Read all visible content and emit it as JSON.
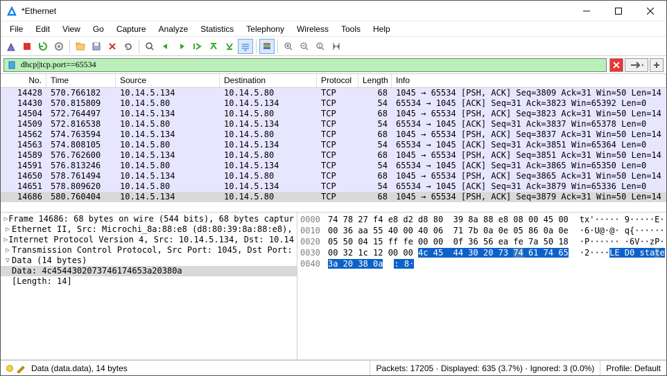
{
  "window": {
    "title": "*Ethernet"
  },
  "menu": [
    "File",
    "Edit",
    "View",
    "Go",
    "Capture",
    "Analyze",
    "Statistics",
    "Telephony",
    "Wireless",
    "Tools",
    "Help"
  ],
  "filter": {
    "text": "dhcp||tcp.port==65534"
  },
  "columns": {
    "no": "No.",
    "time": "Time",
    "source": "Source",
    "destination": "Destination",
    "protocol": "Protocol",
    "length": "Length",
    "info": "Info"
  },
  "packets": [
    {
      "no": "14428",
      "time": "570.766182",
      "src": "10.14.5.134",
      "dst": "10.14.5.80",
      "proto": "TCP",
      "len": "68",
      "info": "1045 → 65534 [PSH, ACK] Seq=3809 Ack=31 Win=50 Len=14"
    },
    {
      "no": "14430",
      "time": "570.815809",
      "src": "10.14.5.80",
      "dst": "10.14.5.134",
      "proto": "TCP",
      "len": "54",
      "info": "65534 → 1045 [ACK] Seq=31 Ack=3823 Win=65392 Len=0"
    },
    {
      "no": "14504",
      "time": "572.764497",
      "src": "10.14.5.134",
      "dst": "10.14.5.80",
      "proto": "TCP",
      "len": "68",
      "info": "1045 → 65534 [PSH, ACK] Seq=3823 Ack=31 Win=50 Len=14"
    },
    {
      "no": "14509",
      "time": "572.816538",
      "src": "10.14.5.80",
      "dst": "10.14.5.134",
      "proto": "TCP",
      "len": "54",
      "info": "65534 → 1045 [ACK] Seq=31 Ack=3837 Win=65378 Len=0"
    },
    {
      "no": "14562",
      "time": "574.763594",
      "src": "10.14.5.134",
      "dst": "10.14.5.80",
      "proto": "TCP",
      "len": "68",
      "info": "1045 → 65534 [PSH, ACK] Seq=3837 Ack=31 Win=50 Len=14"
    },
    {
      "no": "14563",
      "time": "574.808105",
      "src": "10.14.5.80",
      "dst": "10.14.5.134",
      "proto": "TCP",
      "len": "54",
      "info": "65534 → 1045 [ACK] Seq=31 Ack=3851 Win=65364 Len=0"
    },
    {
      "no": "14589",
      "time": "576.762600",
      "src": "10.14.5.134",
      "dst": "10.14.5.80",
      "proto": "TCP",
      "len": "68",
      "info": "1045 → 65534 [PSH, ACK] Seq=3851 Ack=31 Win=50 Len=14"
    },
    {
      "no": "14591",
      "time": "576.813246",
      "src": "10.14.5.80",
      "dst": "10.14.5.134",
      "proto": "TCP",
      "len": "54",
      "info": "65534 → 1045 [ACK] Seq=31 Ack=3865 Win=65350 Len=0"
    },
    {
      "no": "14650",
      "time": "578.761494",
      "src": "10.14.5.134",
      "dst": "10.14.5.80",
      "proto": "TCP",
      "len": "68",
      "info": "1045 → 65534 [PSH, ACK] Seq=3865 Ack=31 Win=50 Len=14"
    },
    {
      "no": "14651",
      "time": "578.809620",
      "src": "10.14.5.80",
      "dst": "10.14.5.134",
      "proto": "TCP",
      "len": "54",
      "info": "65534 → 1045 [ACK] Seq=31 Ack=3879 Win=65336 Len=0"
    },
    {
      "no": "14686",
      "time": "580.760404",
      "src": "10.14.5.134",
      "dst": "10.14.5.80",
      "proto": "TCP",
      "len": "68",
      "info": "1045 → 65534 [PSH, ACK] Seq=3879 Ack=31 Win=50 Len=14",
      "sel": true
    }
  ],
  "tree": [
    {
      "exp": ">",
      "text": "Frame 14686: 68 bytes on wire (544 bits), 68 bytes captur"
    },
    {
      "exp": ">",
      "text": "Ethernet II, Src: Microchi_8a:88:e8 (d8:80:39:8a:88:e8),"
    },
    {
      "exp": ">",
      "text": "Internet Protocol Version 4, Src: 10.14.5.134, Dst: 10.14"
    },
    {
      "exp": ">",
      "text": "Transmission Control Protocol, Src Port: 1045, Dst Port:"
    },
    {
      "exp": "v",
      "text": "Data (14 bytes)"
    },
    {
      "exp": "",
      "text": "    Data: 4c4544302073746174653a20380a",
      "sel": true
    },
    {
      "exp": "",
      "text": "    [Length: 14]"
    }
  ],
  "hex": [
    {
      "off": "0000",
      "b": "74 78 27 f4 e8 d2 d8 80  39 8a 88 e8 08 00 45 00",
      "a": "tx'····· 9·····E·"
    },
    {
      "off": "0010",
      "b": "00 36 aa 55 40 00 40 06  71 7b 0a 0e 05 86 0a 0e",
      "a": "·6·U@·@· q{······"
    },
    {
      "off": "0020",
      "b": "05 50 04 15 ff fe 00 00  0f 36 56 ea fe 7a 50 18",
      "a": "·P······ ·6V··zP·"
    },
    {
      "off": "0030",
      "b": "00 32 1c 12 00 00 ",
      "b2": "4c 45  44 30 20 73 ",
      "b3": "74",
      "b4": " 61 74 65",
      "a": "·2····",
      "a2": "LE D0 sta",
      "a3": "t",
      "a4": "e"
    },
    {
      "off": "0040",
      "b": "",
      "b2": "3a 20 38 0a",
      "a": "",
      "a2": ": 8·"
    }
  ],
  "status": {
    "left": "Data (data.data), 14 bytes",
    "center": "Packets: 17205 · Displayed: 635 (3.7%) · Ignored: 3 (0.0%)",
    "right": "Profile: Default"
  }
}
